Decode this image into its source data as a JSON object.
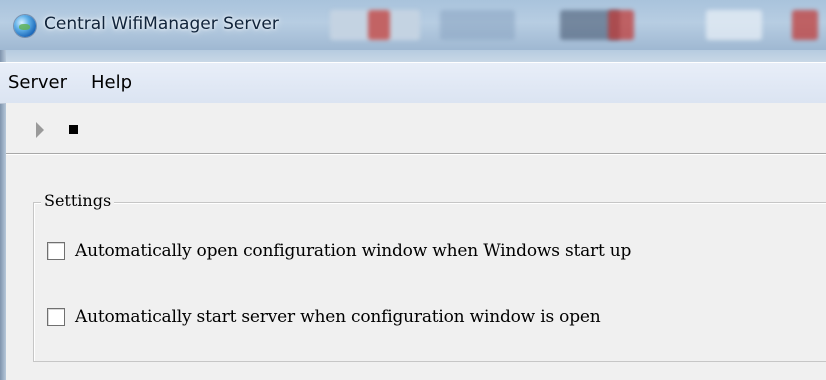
{
  "window": {
    "title": "Central WifiManager Server",
    "icon": "globe-app-icon"
  },
  "menubar": {
    "items": [
      {
        "label": "Server"
      },
      {
        "label": "Help"
      }
    ]
  },
  "toolbar": {
    "buttons": [
      {
        "icon": "play-icon",
        "state": "disabled"
      },
      {
        "icon": "stop-icon",
        "state": "enabled"
      }
    ]
  },
  "settings": {
    "group_label": "Settings",
    "options": [
      {
        "label": "Automatically open configuration window when Windows start up",
        "checked": false
      },
      {
        "label": "Automatically start server when configuration window is open",
        "checked": false
      }
    ]
  },
  "colors": {
    "titlebar": "#a9c3dc",
    "menubar": "#dbe4f2",
    "window_bg": "#f0f0f0"
  }
}
